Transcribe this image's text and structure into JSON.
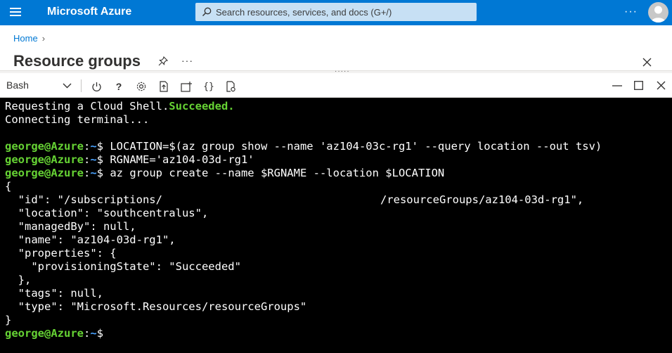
{
  "header": {
    "brand": "Microsoft Azure",
    "search_placeholder": "Search resources, services, and docs (G+/)",
    "more": "···"
  },
  "breadcrumb": {
    "home": "Home"
  },
  "page": {
    "title": "Resource groups",
    "more": "···"
  },
  "shell": {
    "type": "Bash",
    "grip": "·····"
  },
  "terminal": {
    "line1_prefix": "Requesting a Cloud Shell.",
    "line1_status": "Succeeded.",
    "line2": "Connecting terminal...",
    "prompt_user": "george@Azure",
    "prompt_sep": ":",
    "prompt_path": "~",
    "prompt_dollar": "$ ",
    "cmd1": "LOCATION=$(az group show --name 'az104-03c-rg1' --query location --out tsv)",
    "cmd2": "RGNAME='az104-03d-rg1'",
    "cmd3": "az group create --name $RGNAME --location $LOCATION",
    "out_open": "{",
    "out_id_a": "  \"id\": \"/subscriptions/",
    "out_id_b": "/resourceGroups/az104-03d-rg1\",",
    "out_location": "  \"location\": \"southcentralus\",",
    "out_managed": "  \"managedBy\": null,",
    "out_name": "  \"name\": \"az104-03d-rg1\",",
    "out_props": "  \"properties\": {",
    "out_prov": "    \"provisioningState\": \"Succeeded\"",
    "out_props_close": "  },",
    "out_tags": "  \"tags\": null,",
    "out_type": "  \"type\": \"Microsoft.Resources/resourceGroups\"",
    "out_close": "}"
  }
}
